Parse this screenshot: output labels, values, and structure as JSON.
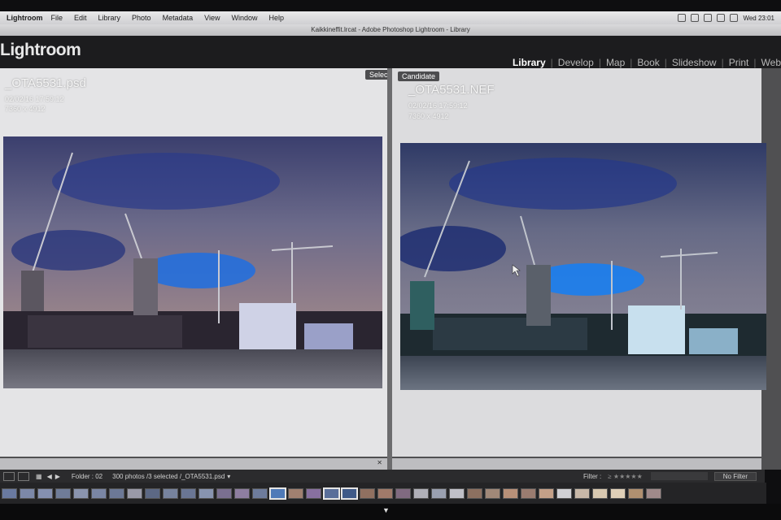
{
  "menubar": {
    "app": "Lightroom",
    "items": [
      "File",
      "Edit",
      "Library",
      "Photo",
      "Metadata",
      "View",
      "Window",
      "Help"
    ],
    "clock": "Wed 23:01"
  },
  "window": {
    "title": "Kaikkineffit.lrcat - Adobe Photoshop Lightroom - Library"
  },
  "header": {
    "logo": "Lightroom",
    "modules": [
      "Library",
      "Develop",
      "Map",
      "Book",
      "Slideshow",
      "Print",
      "Web"
    ],
    "active_module": "Library"
  },
  "compare": {
    "select": {
      "tag": "Select",
      "filename": "_OTA5531.psd",
      "datetime": "02/02/16 17:59:12",
      "dimensions": "7360 x 4912"
    },
    "candidate": {
      "tag": "Candidate",
      "filename": "_OTA5531.NEF",
      "datetime": "02/02/16 17:59:12",
      "dimensions": "7360 x 4912"
    }
  },
  "toolbar": {
    "folder_label": "Folder : 02",
    "status": "300 photos /3 selected /_OTA5531.psd",
    "filter_label": "Filter :",
    "filter_value": "No Filter"
  },
  "colors": {
    "header_bg": "#1c1c1e",
    "active_module": "#ffffff",
    "pane_bg": "#e4e4e6",
    "filmstrip_bg": "#242426"
  }
}
